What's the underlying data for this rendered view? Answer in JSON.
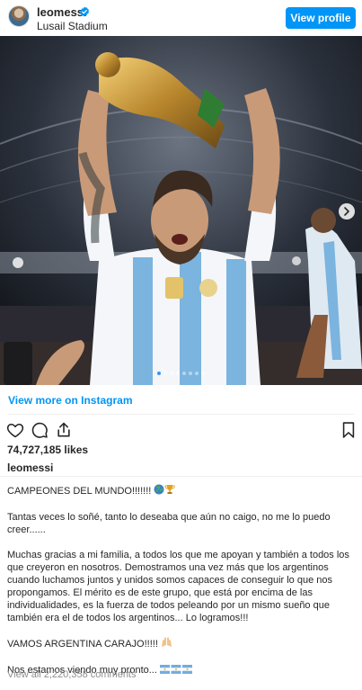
{
  "header": {
    "username": "leomessi",
    "location": "Lusail Stadium",
    "view_profile_label": "View profile"
  },
  "photo": {
    "carousel": {
      "slide_count": 8,
      "active_index": 0
    }
  },
  "view_more_label": "View more on Instagram",
  "actions": {
    "likes": "74,727,185 likes",
    "caption_username": "leomessi"
  },
  "caption": {
    "p1": "CAMPEONES DEL MUNDO!!!!!!!",
    "p2": "Tantas veces lo soñé, tanto lo deseaba que aún no caigo, no me lo puedo creer......",
    "p3": "Muchas gracias a mi familia, a todos los que me apoyan y también a todos los que creyeron en nosotros. Demostramos una vez más que los argentinos cuando luchamos juntos y unidos somos capaces de conseguir lo que nos propongamos. El mérito es de este grupo, que está por encima de las individualidades, es la fuerza de todos peleando por un mismo sueño que también era el de todos los argentinos... Lo logramos!!!",
    "p4": "VAMOS ARGENTINA CARAJO!!!!!",
    "p5": "Nos estamos viendo muy pronto..."
  },
  "comments_link": "View all 2,220,358 comments",
  "colors": {
    "accent": "#0095f6",
    "text": "#262626",
    "muted": "#8e8e8e",
    "jersey_blue": "#7bb4de"
  }
}
